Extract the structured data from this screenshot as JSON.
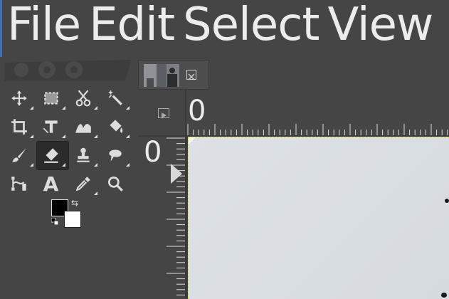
{
  "menu": [
    "File",
    "Edit",
    "Select",
    "View"
  ],
  "tools": [
    {
      "name": "move-tool",
      "icon": "move-icon",
      "active": false,
      "has_group": true
    },
    {
      "name": "rect-select-tool",
      "icon": "rect-select-icon",
      "active": false,
      "has_group": true
    },
    {
      "name": "scissors-select-tool",
      "icon": "scissors-icon",
      "active": false,
      "has_group": true
    },
    {
      "name": "fuzzy-select-tool",
      "icon": "magic-wand-icon",
      "active": false,
      "has_group": true
    },
    {
      "name": "crop-tool",
      "icon": "crop-icon",
      "active": false,
      "has_group": true
    },
    {
      "name": "unified-transform-tool",
      "icon": "transform-icon",
      "active": false,
      "has_group": true
    },
    {
      "name": "warp-transform-tool",
      "icon": "warp-icon",
      "active": false,
      "has_group": true
    },
    {
      "name": "bucket-fill-tool",
      "icon": "bucket-icon",
      "active": false,
      "has_group": true
    },
    {
      "name": "paintbrush-tool",
      "icon": "paintbrush-icon",
      "active": false,
      "has_group": true
    },
    {
      "name": "eraser-tool",
      "icon": "eraser-icon",
      "active": true,
      "has_group": true
    },
    {
      "name": "clone-tool",
      "icon": "clone-stamp-icon",
      "active": false,
      "has_group": true
    },
    {
      "name": "smudge-tool",
      "icon": "smudge-icon",
      "active": false,
      "has_group": true
    },
    {
      "name": "paths-tool",
      "icon": "paths-icon",
      "active": false,
      "has_group": false
    },
    {
      "name": "text-tool",
      "icon": "text-icon",
      "active": false,
      "has_group": false
    },
    {
      "name": "color-picker-tool",
      "icon": "eyedropper-icon",
      "active": false,
      "has_group": true
    },
    {
      "name": "zoom-tool",
      "icon": "zoom-icon",
      "active": false,
      "has_group": true
    }
  ],
  "text_tool_glyph": "A",
  "colors": {
    "foreground": "#000000",
    "background": "#ffffff",
    "swap_glyph": "⇆"
  },
  "rulers": {
    "horizontal_origin": "0",
    "vertical_origin": "0"
  }
}
